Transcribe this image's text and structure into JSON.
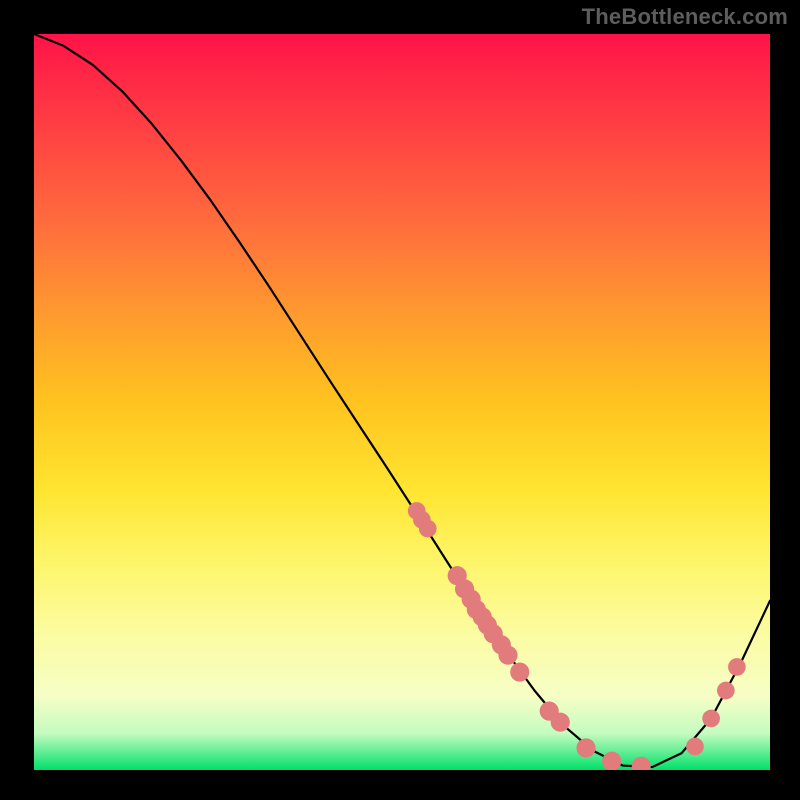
{
  "watermark": "TheBottleneck.com",
  "chart_data": {
    "type": "line",
    "title": "",
    "xlabel": "",
    "ylabel": "",
    "xlim": [
      0,
      100
    ],
    "ylim": [
      0,
      100
    ],
    "grid": false,
    "legend": false,
    "x": [
      0,
      4,
      8,
      12,
      16,
      20,
      24,
      28,
      32,
      36,
      40,
      44,
      48,
      52,
      56,
      60,
      64,
      68,
      72,
      76,
      80,
      84,
      88,
      92,
      96,
      100
    ],
    "values": [
      100,
      98.4,
      95.8,
      92.2,
      87.8,
      82.8,
      77.4,
      71.6,
      65.6,
      59.4,
      53.2,
      47.1,
      41.0,
      34.8,
      28.5,
      22.3,
      16.3,
      10.8,
      6.0,
      2.6,
      0.6,
      0.4,
      2.3,
      7.0,
      14.5,
      23.0
    ],
    "markers": [
      {
        "x": 52.0,
        "y": 35.2,
        "r": 1.2
      },
      {
        "x": 52.7,
        "y": 34.0,
        "r": 1.2
      },
      {
        "x": 53.5,
        "y": 32.8,
        "r": 1.2
      },
      {
        "x": 57.5,
        "y": 26.4,
        "r": 1.3
      },
      {
        "x": 58.5,
        "y": 24.6,
        "r": 1.3
      },
      {
        "x": 59.4,
        "y": 23.2,
        "r": 1.3
      },
      {
        "x": 60.1,
        "y": 21.8,
        "r": 1.3
      },
      {
        "x": 60.9,
        "y": 20.8,
        "r": 1.3
      },
      {
        "x": 61.6,
        "y": 19.7,
        "r": 1.3
      },
      {
        "x": 62.4,
        "y": 18.5,
        "r": 1.3
      },
      {
        "x": 63.5,
        "y": 17.0,
        "r": 1.3
      },
      {
        "x": 64.4,
        "y": 15.6,
        "r": 1.3
      },
      {
        "x": 66.0,
        "y": 13.3,
        "r": 1.3
      },
      {
        "x": 70.0,
        "y": 8.0,
        "r": 1.3
      },
      {
        "x": 71.5,
        "y": 6.5,
        "r": 1.3
      },
      {
        "x": 75.0,
        "y": 3.0,
        "r": 1.3
      },
      {
        "x": 78.5,
        "y": 1.2,
        "r": 1.3
      },
      {
        "x": 82.5,
        "y": 0.5,
        "r": 1.3
      },
      {
        "x": 89.8,
        "y": 3.2,
        "r": 1.2
      },
      {
        "x": 92.0,
        "y": 7.0,
        "r": 1.2
      },
      {
        "x": 94.0,
        "y": 10.8,
        "r": 1.2
      },
      {
        "x": 95.5,
        "y": 14.0,
        "r": 1.2
      }
    ],
    "background_gradient": {
      "stops": [
        {
          "pos": 0.0,
          "color": "#ff1348"
        },
        {
          "pos": 0.12,
          "color": "#ff3d43"
        },
        {
          "pos": 0.25,
          "color": "#ff6a3d"
        },
        {
          "pos": 0.38,
          "color": "#ff9a2f"
        },
        {
          "pos": 0.5,
          "color": "#ffc31f"
        },
        {
          "pos": 0.62,
          "color": "#ffe531"
        },
        {
          "pos": 0.72,
          "color": "#fdf66b"
        },
        {
          "pos": 0.82,
          "color": "#fbfca4"
        },
        {
          "pos": 0.9,
          "color": "#f6fec6"
        },
        {
          "pos": 0.95,
          "color": "#c5fcc0"
        },
        {
          "pos": 1.0,
          "color": "#00e06a"
        }
      ]
    },
    "marker_color": "#e27b7b",
    "line_color": "#000000"
  }
}
